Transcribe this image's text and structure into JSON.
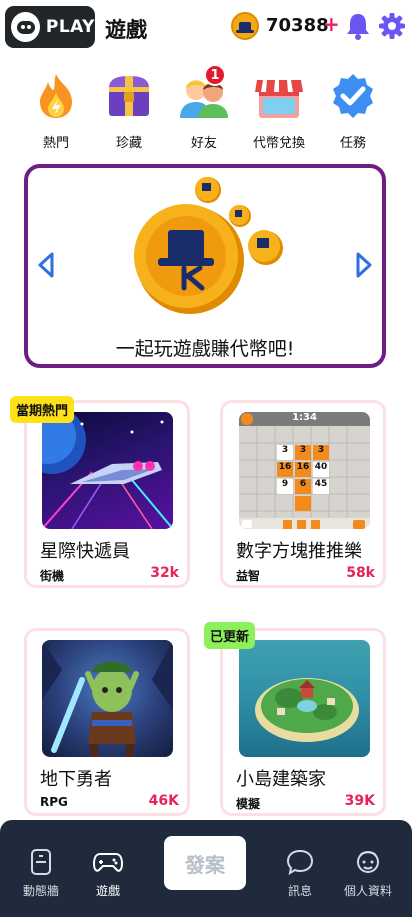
{
  "header": {
    "logo_text": "PLAY",
    "title": "遊戲",
    "coin_balance": "70388",
    "coin_add": "+"
  },
  "quick_menu": [
    {
      "label": "熱門",
      "icon": "fire-icon"
    },
    {
      "label": "珍藏",
      "icon": "treasure-chest-icon"
    },
    {
      "label": "好友",
      "icon": "friends-icon",
      "badge": "1"
    },
    {
      "label": "代幣兌換",
      "icon": "shop-icon"
    },
    {
      "label": "任務",
      "icon": "check-badge-icon"
    }
  ],
  "banner": {
    "text": "一起玩遊戲賺代幣吧!"
  },
  "games": [
    {
      "name": "星際快遞員",
      "category": "街機",
      "count": "32k",
      "tag": "當期熱門"
    },
    {
      "name": "數字方塊推推樂",
      "category": "益智",
      "count": "58k"
    },
    {
      "name": "地下勇者",
      "category": "RPG",
      "count": "46K"
    },
    {
      "name": "小島建築家",
      "category": "模擬",
      "count": "39K",
      "tag": "已更新"
    }
  ],
  "puzzle_preview": {
    "timer": "1:34",
    "numbers": [
      "3",
      "3",
      "3",
      "16",
      "16",
      "40",
      "9",
      "6",
      "45"
    ]
  },
  "bottom_nav": {
    "feed": "動態牆",
    "games": "遊戲",
    "post": "發案",
    "messages": "訊息",
    "profile": "個人資料"
  },
  "colors": {
    "accent_pink": "#e6235a",
    "banner_border": "#6e1d84",
    "nav_bg": "#1f2b3c",
    "hot_tag": "#ffe11a",
    "updated_tag": "#8cf05a"
  }
}
